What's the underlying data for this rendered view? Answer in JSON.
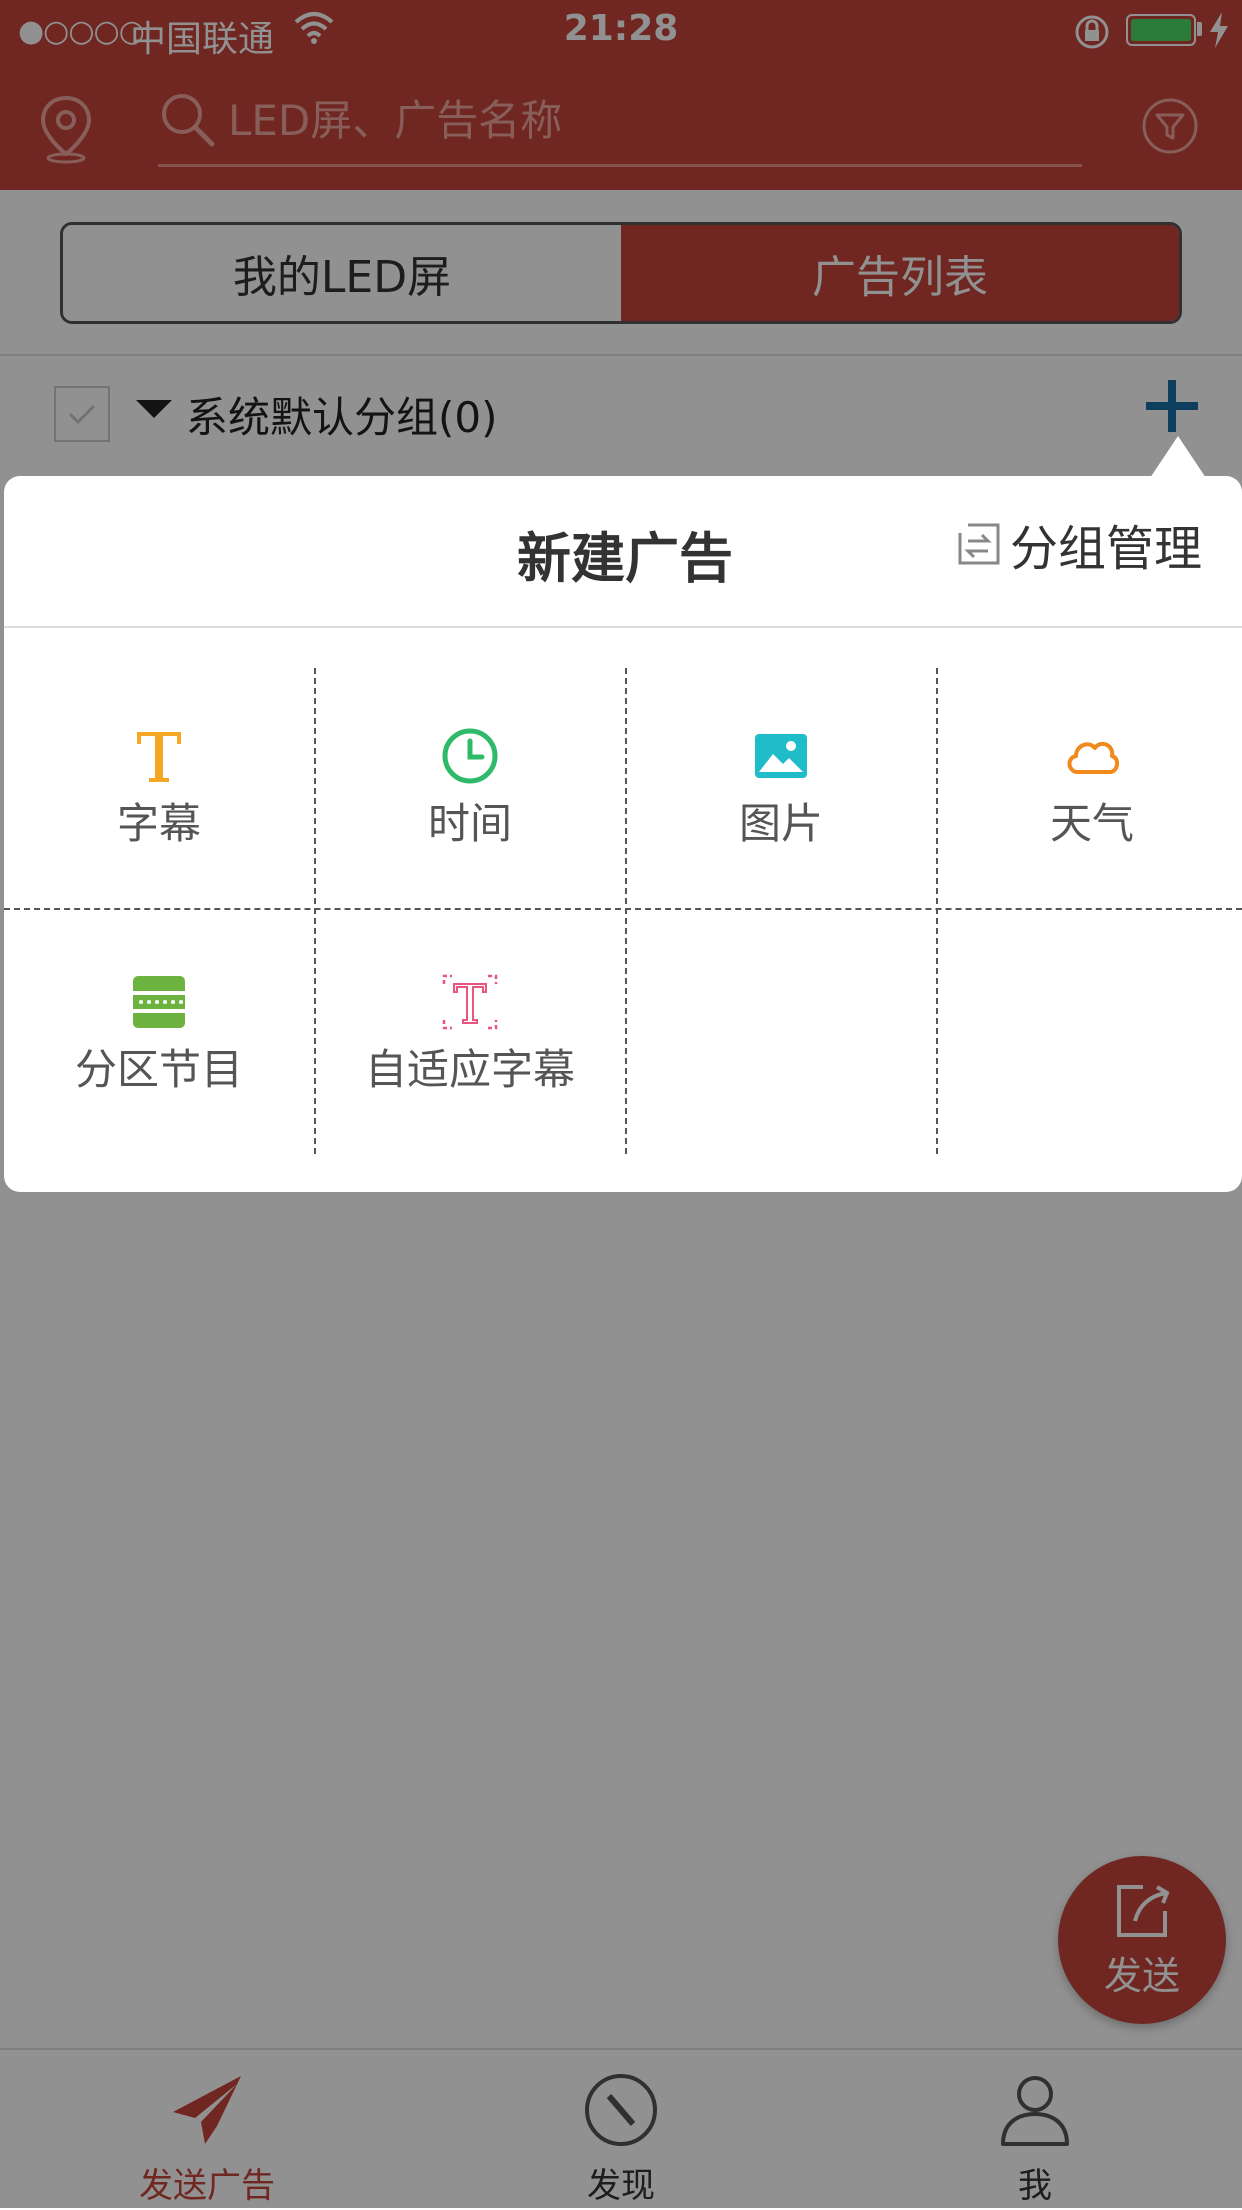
{
  "status_bar": {
    "signal": "●○○○○",
    "carrier": "中国联通",
    "time": "21:28"
  },
  "header": {
    "search_placeholder": "LED屏、广告名称"
  },
  "segment": {
    "left_label": "我的LED屏",
    "right_label": "广告列表",
    "selected": "广告列表"
  },
  "group": {
    "label": "系统默认分组(0)"
  },
  "popup": {
    "title": "新建广告",
    "group_mgmt_label": "分组管理",
    "items": [
      {
        "label": "字幕",
        "icon": "text-t-icon",
        "color": "#f5a623"
      },
      {
        "label": "时间",
        "icon": "clock-icon",
        "color": "#2fba6a"
      },
      {
        "label": "图片",
        "icon": "image-icon",
        "color": "#20bcc9"
      },
      {
        "label": "天气",
        "icon": "cloud-icon",
        "color": "#f08a1c"
      },
      {
        "label": "分区节目",
        "icon": "partition-icon",
        "color": "#6db33f"
      },
      {
        "label": "自适应字幕",
        "icon": "adaptive-text-icon",
        "color": "#e8557f"
      }
    ]
  },
  "fab": {
    "label": "发送"
  },
  "tabbar": {
    "tabs": [
      {
        "label": "发送广告",
        "icon": "paper-plane-icon",
        "active": true
      },
      {
        "label": "发现",
        "icon": "compass-icon",
        "active": false
      },
      {
        "label": "我",
        "icon": "user-icon",
        "active": false
      }
    ]
  },
  "colors": {
    "brand": "#c5453b",
    "overlay": "rgba(0,0,0,0.43)"
  }
}
